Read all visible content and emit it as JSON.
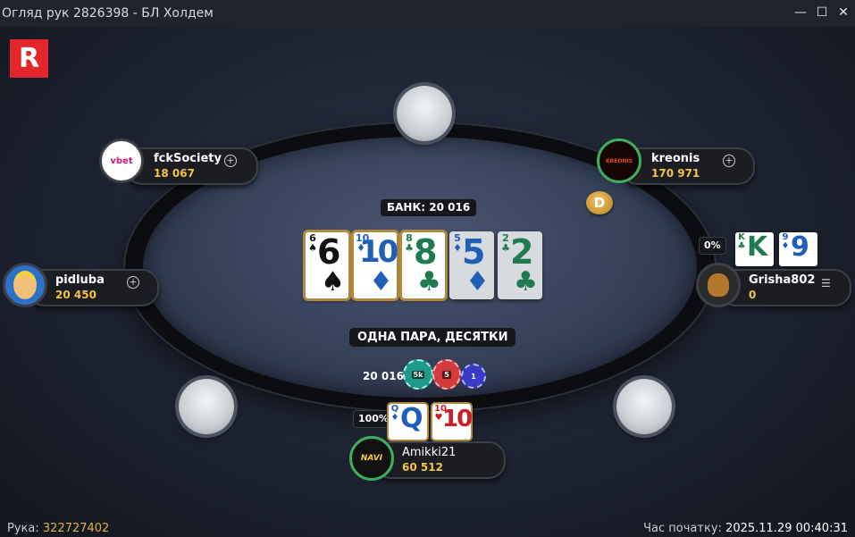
{
  "window": {
    "title": "Огляд рук 2826398 - БЛ Холдем",
    "minimize_glyph": "—",
    "maximize_glyph": "☐",
    "close_glyph": "✕"
  },
  "logo": {
    "letter": "R",
    "color": "#e3262b"
  },
  "pot": {
    "label": "БАНК: 20 016"
  },
  "board": [
    {
      "rank": "6",
      "suit": "♠",
      "color": "#111111",
      "highlighted": true
    },
    {
      "rank": "10",
      "suit": "♦",
      "color": "#1f5fb6",
      "highlighted": true
    },
    {
      "rank": "8",
      "suit": "♣",
      "color": "#1f7a4f",
      "highlighted": true
    },
    {
      "rank": "5",
      "suit": "♦",
      "color": "#1f5fb6",
      "highlighted": false
    },
    {
      "rank": "2",
      "suit": "♣",
      "color": "#1f7a4f",
      "highlighted": false
    }
  ],
  "hand_result": "ОДНА ПАРА, ДЕСЯТКИ",
  "chips": {
    "total": "20 016",
    "stacks": [
      {
        "label": "5k",
        "color": "#1f9a8a"
      },
      {
        "label": "5",
        "color": "#d33a3a"
      },
      {
        "label": "1",
        "color": "#3a3ac7"
      }
    ]
  },
  "players": {
    "fcksociety": {
      "name": "fckSociety",
      "stack": "18 067",
      "avatar_text": "vbet"
    },
    "kreonis": {
      "name": "kreonis",
      "stack": "170 971",
      "avatar_text": "KREONIS"
    },
    "pidluba": {
      "name": "pidluba",
      "stack": "20 450"
    },
    "grisha": {
      "name": "Grisha802",
      "stack": "0",
      "equity": "0%",
      "cards": [
        {
          "rank": "K",
          "suit": "♣",
          "color": "#1f7a4f"
        },
        {
          "rank": "9",
          "suit": "♦",
          "color": "#1f5fb6"
        }
      ]
    },
    "amikki": {
      "name": "Amikki21",
      "stack": "60 512",
      "equity": "100%",
      "avatar_text": "NAVI",
      "cards": [
        {
          "rank": "Q",
          "suit": "♦",
          "color": "#1f5fb6"
        },
        {
          "rank": "10",
          "suit": "♥",
          "color": "#c8202b"
        }
      ]
    }
  },
  "dealer_button": "D",
  "footer": {
    "hand_label": "Рука:",
    "hand_number": "322727402",
    "start_label": "Час початку:",
    "start_time": "2025.11.29 00:40:31"
  }
}
